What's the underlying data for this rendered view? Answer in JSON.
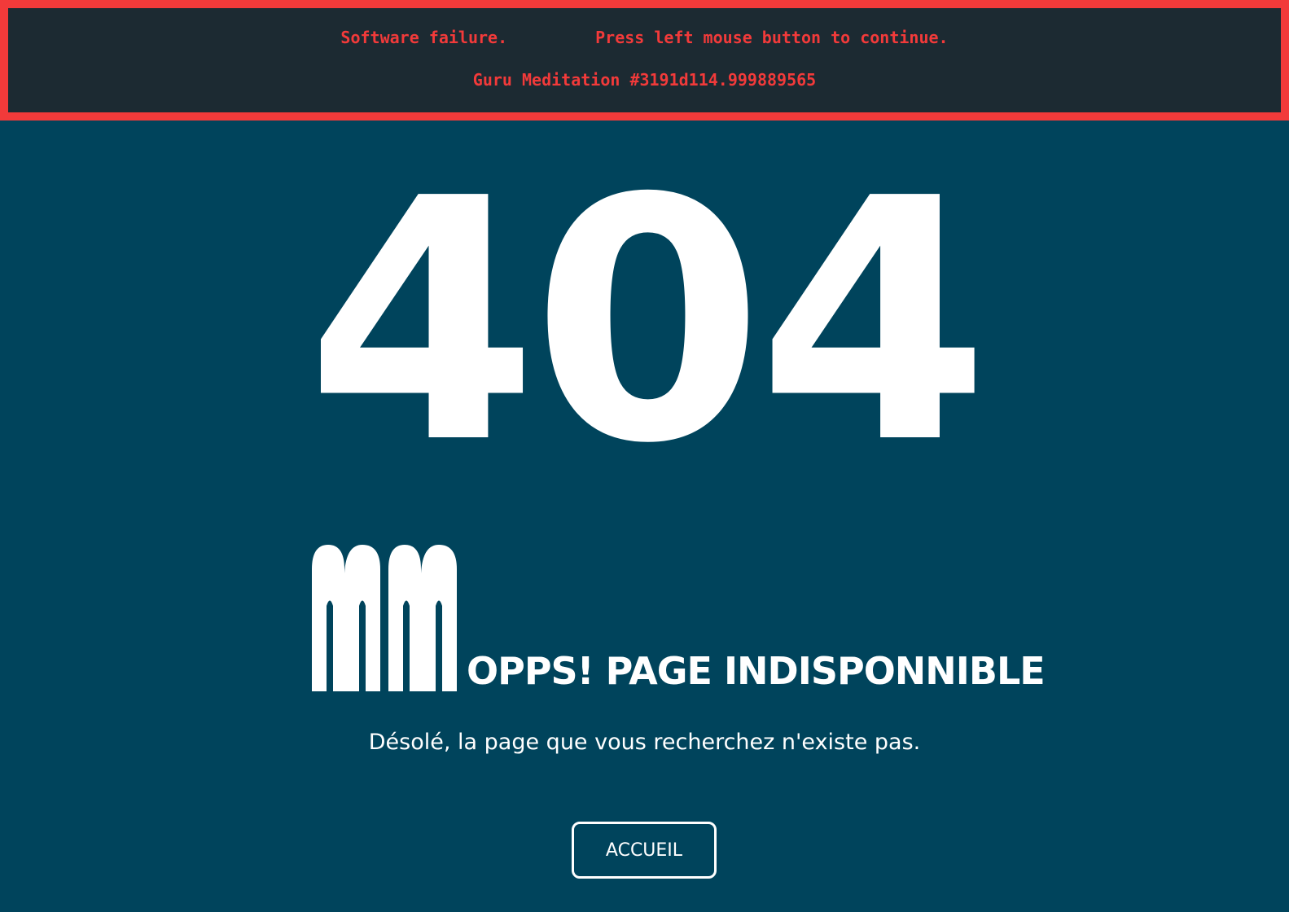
{
  "guru_meditation": {
    "failure_text": "Software failure.",
    "continue_text": "Press left mouse button to continue.",
    "code_text": "Guru Meditation #3191d114.999889565",
    "border_color": "#f23a3a",
    "background_color": "#1c2a32"
  },
  "error": {
    "code": "404",
    "headline": "OPPS! PAGE INDISPONNIBLE",
    "message": "Désolé, la page que vous recherchez n'existe pas.",
    "logo_icon": "mm-logo-icon"
  },
  "actions": {
    "home_label": "ACCUEIL"
  },
  "theme": {
    "page_background": "#00445c",
    "text_color": "#ffffff"
  }
}
